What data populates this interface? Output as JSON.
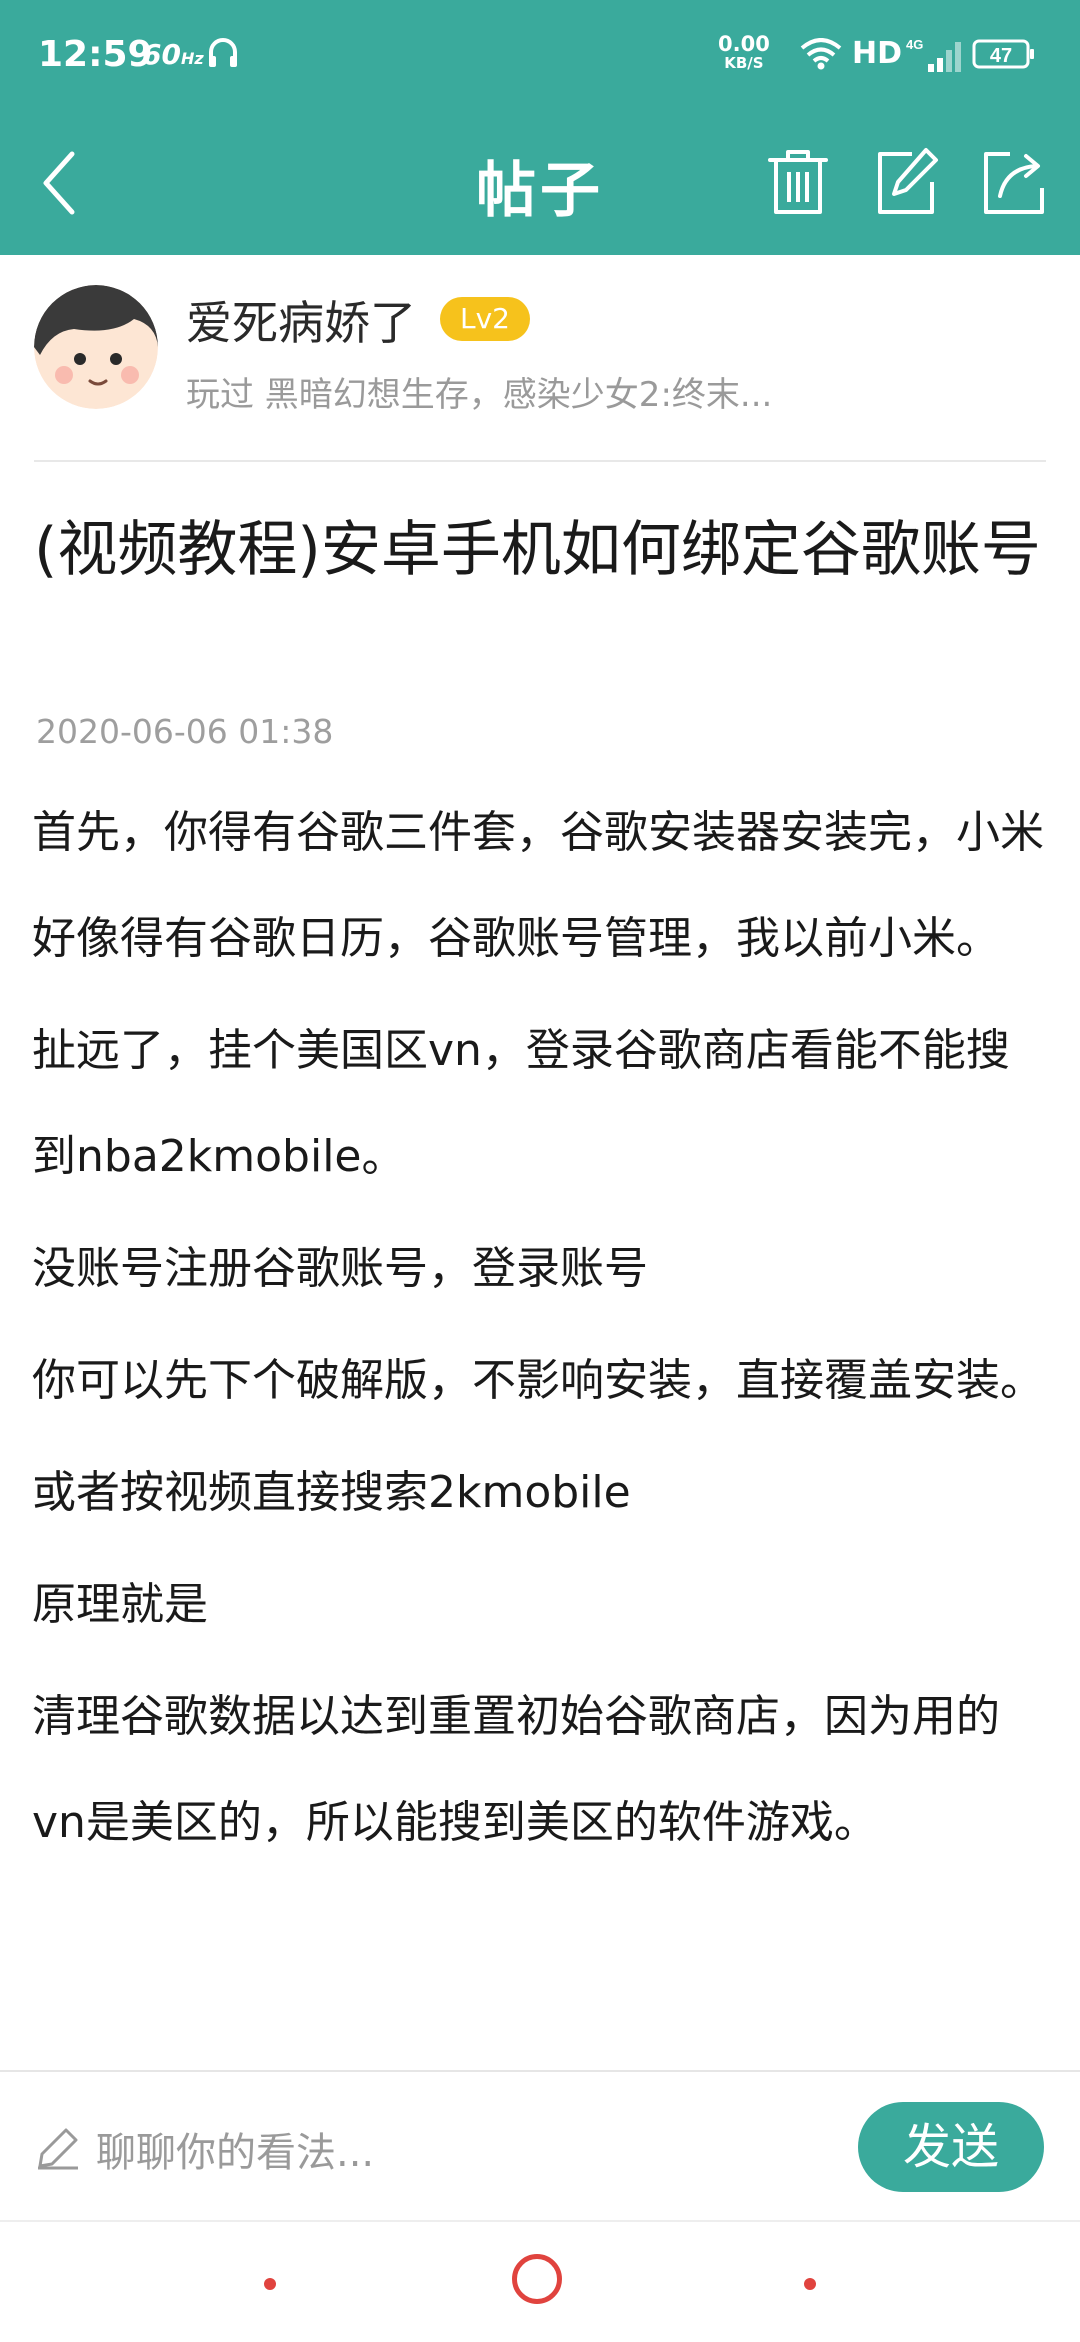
{
  "status_bar": {
    "time": "12:59",
    "refresh": "60",
    "refresh_unit": "Hz",
    "net_speed": "0.00",
    "net_unit": "KB/S",
    "hd": "HD",
    "network": "4G",
    "battery": "47"
  },
  "header": {
    "title": "帖子",
    "bg_color": "#3aaa9c"
  },
  "author": {
    "name": "爱死病娇了",
    "level": "Lv2",
    "played": "玩过 黑暗幻想生存，感染少女2:终末..."
  },
  "post": {
    "title": "(视频教程)安卓手机如何绑定谷歌账号",
    "date": "2020-06-06 01:38",
    "paragraphs": [
      "首先，你得有谷歌三件套，谷歌安装器安装完，小米好像得有谷歌日历，谷歌账号管理，我以前小米。",
      "扯远了，挂个美国区vn，登录谷歌商店看能不能搜到nba2kmobile。",
      "没账号注册谷歌账号，登录账号",
      "你可以先下个破解版，不影响安装，直接覆盖安装。",
      "或者按视频直接搜索2kmobile",
      "原理就是",
      "清理谷歌数据以达到重置初始谷歌商店，因为用的vn是美区的，所以能搜到美区的软件游戏。"
    ]
  },
  "comment": {
    "placeholder": "聊聊你的看法...",
    "send_label": "发送"
  },
  "icons": {
    "back": "back-arrow-icon",
    "delete": "trash-icon",
    "edit": "edit-icon",
    "share": "share-icon",
    "pen": "pencil-icon"
  },
  "colors": {
    "accent": "#3aaa9c",
    "level_badge": "#f6c21c",
    "nav": "#e0433e"
  }
}
